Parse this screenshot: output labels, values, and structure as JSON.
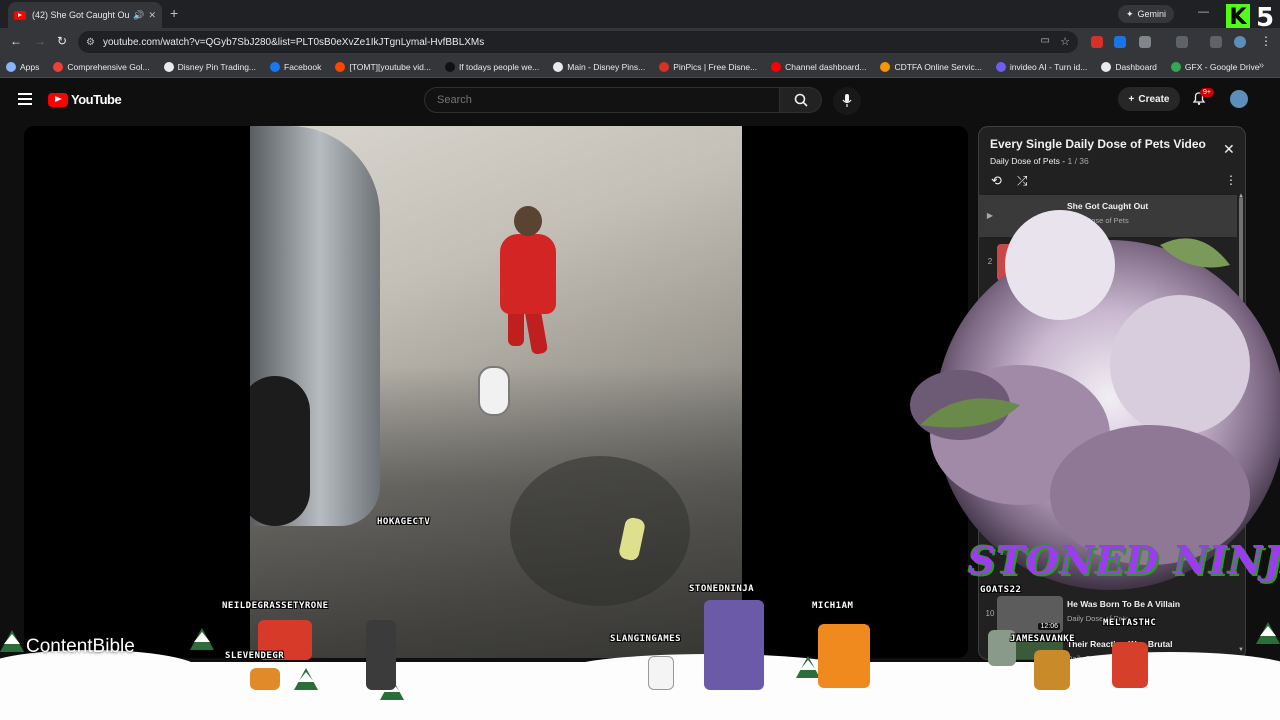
{
  "browser": {
    "tab_title": "(42) She Got Caught Out - YouTube",
    "new_tab": "+",
    "gemini_label": "Gemini",
    "url": "youtube.com/watch?v=QGyb7SbJ280&list=PLT0sB0eXvZe1IkJTgnLymal-HvfBBLXMs",
    "kick_logo": "K",
    "kick_number": "5",
    "bookmarks": [
      {
        "label": "Apps",
        "color": "#8ab4f8"
      },
      {
        "label": "Comprehensive Gol...",
        "color": "#ea4335"
      },
      {
        "label": "Disney Pin Trading...",
        "color": "#e8eaed"
      },
      {
        "label": "Facebook",
        "color": "#1877f2"
      },
      {
        "label": "[TOMT][youtube vid...",
        "color": "#ff4500"
      },
      {
        "label": "If todays people we...",
        "color": "#111111"
      },
      {
        "label": "Main - Disney Pins...",
        "color": "#e8eaed"
      },
      {
        "label": "PinPics | Free Disne...",
        "color": "#d93025"
      },
      {
        "label": "Channel dashboard...",
        "color": "#ff0000"
      },
      {
        "label": "CDTFA Online Servic...",
        "color": "#f29900"
      },
      {
        "label": "invideo AI - Turn id...",
        "color": "#6f5cf1"
      },
      {
        "label": "Dashboard",
        "color": "#e8eaed"
      },
      {
        "label": "GFX - Google Drive",
        "color": "#34a853"
      }
    ]
  },
  "youtube": {
    "logo_text": "YouTube",
    "search_placeholder": "Search",
    "create_label": "Create",
    "notifications_badge": "9+"
  },
  "video_overlay_names": {
    "hokagectv": "HOKAGECTV",
    "neil": "NEILDEGRASSETYRONE",
    "sleven": "SLEVENDEGR",
    "stonedninja": "STONEDNINJA",
    "slanging": "SLANGINGAMES",
    "mich": "MICH1AM",
    "goats": "GOATS22",
    "meltas": "MELTASTHC",
    "james": "JAMESAVANKE"
  },
  "playlist": {
    "title": "Every Single Daily Dose of Pets Video",
    "channel": "Daily Dose of Pets",
    "position": "1 / 36",
    "items": [
      {
        "index": "▶",
        "title": "She Got Caught Out",
        "channel": "Daily Dose of Pets",
        "duration": "12:21",
        "thumb": "#3a3a3a"
      },
      {
        "index": "2",
        "title": "",
        "channel": "",
        "duration": "12:21",
        "thumb": "#c94848"
      },
      {
        "index": "3",
        "title": "",
        "channel": "",
        "duration": "12:29",
        "thumb": "#b49868"
      },
      {
        "index": "4",
        "title": "",
        "channel": "",
        "duration": "",
        "thumb": "#4e79a8"
      },
      {
        "index": "10",
        "title": "He Was Born To Be A Villain",
        "channel": "Daily Dose of Pets",
        "duration": "12:06",
        "thumb": "#5c5c5c"
      },
      {
        "index": "",
        "title": "Their Reaction Was Brutal",
        "channel": "Daily Dose of Pets",
        "duration": "",
        "thumb": "#3a5a3a"
      }
    ]
  },
  "stream_overlay": {
    "brand_text": "STONED NINJA",
    "content_bible": "ContentBible"
  }
}
